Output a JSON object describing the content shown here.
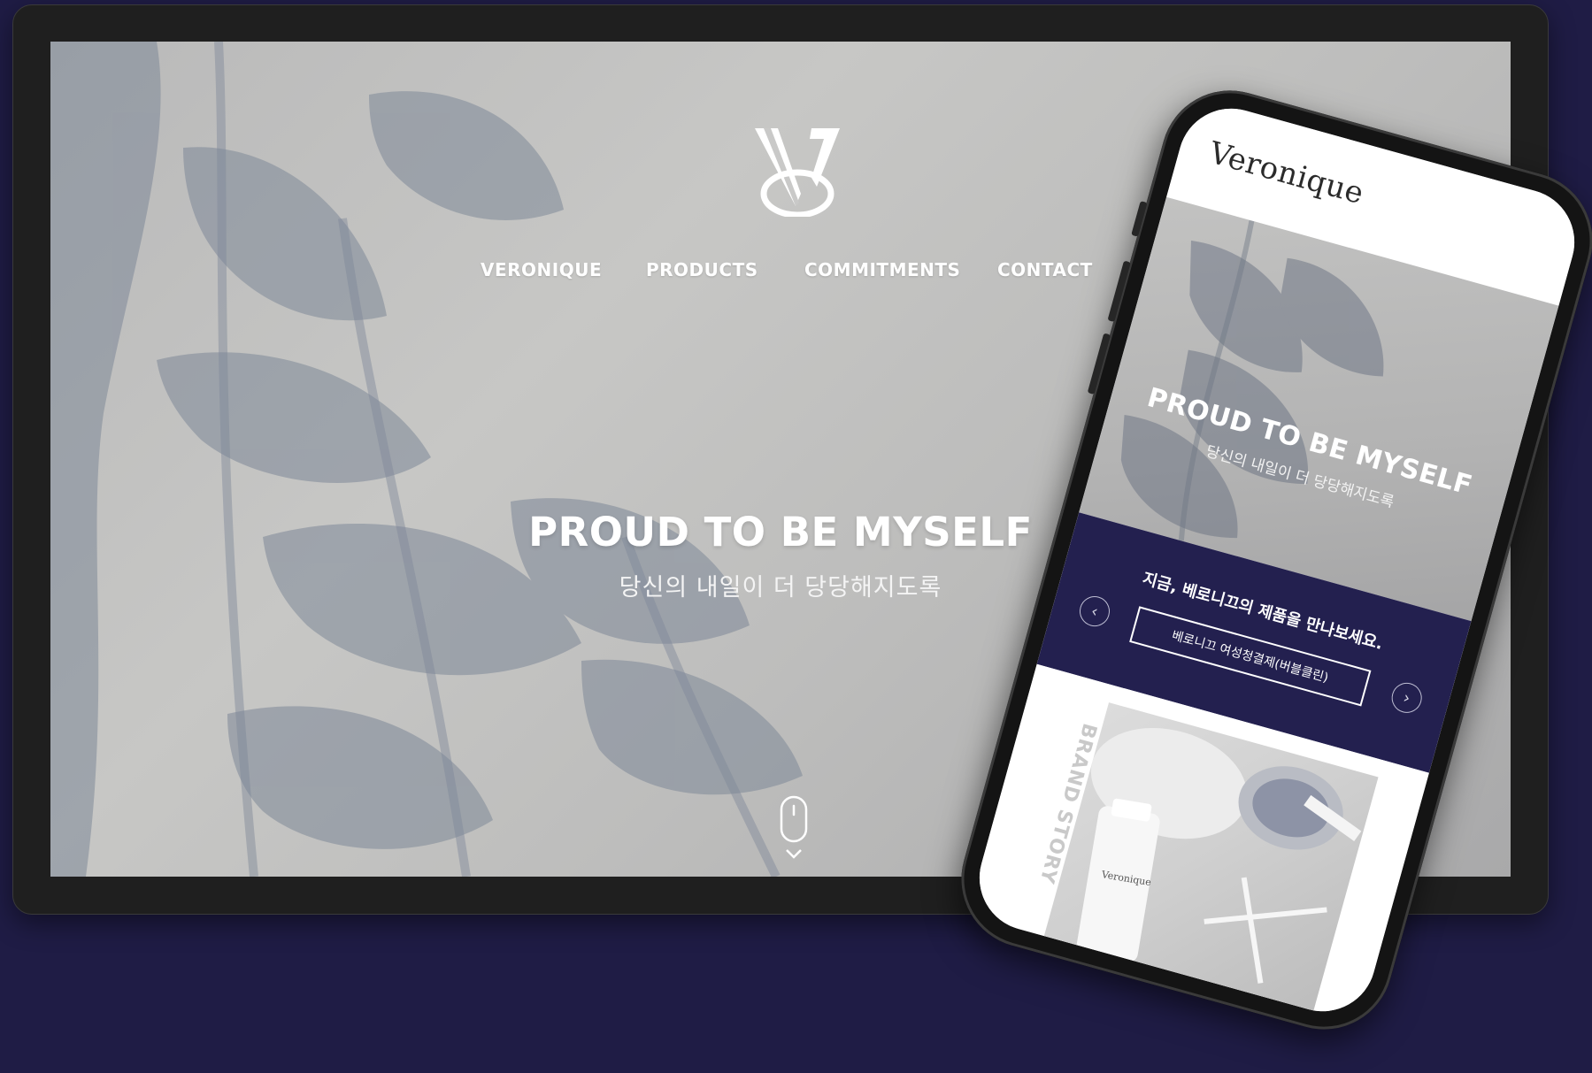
{
  "desktop": {
    "nav": [
      "VERONIQUE",
      "PRODUCTS",
      "COMMITMENTS",
      "CONTACT"
    ],
    "hero_title": "PROUD TO BE MYSELF",
    "hero_subtitle": "당신의 내일이 더 당당해지도록"
  },
  "mobile": {
    "brand": "Veronique",
    "hero_title": "PROUD TO BE MYSELF",
    "hero_subtitle": "당신의 내일이 더 당당해지도록",
    "banner_text": "지금, 베로니끄의 제품을 만나보세요.",
    "banner_button": "베로니끄 여성청결제(버블클린)",
    "story_label": "BRAND STORY",
    "product_label": "Veronique"
  },
  "colors": {
    "background": "#1f1c45",
    "accent_navy": "#23204f",
    "frame": "#1f1f1f"
  },
  "icons": [
    "veronique-logo",
    "mouse-scroll-icon",
    "chevron-down-icon",
    "arrow-left-icon",
    "arrow-right-icon"
  ]
}
